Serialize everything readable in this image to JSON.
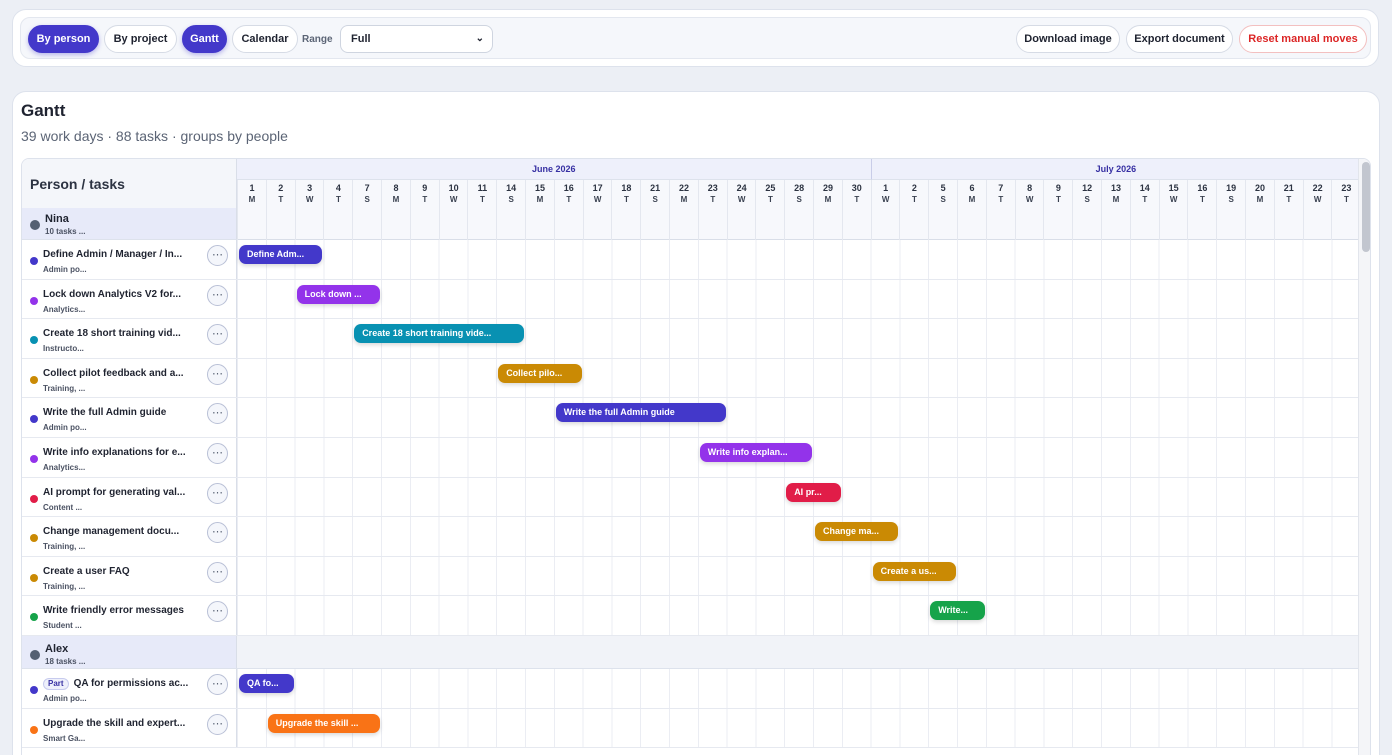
{
  "toolbar": {
    "by_person": "By person",
    "by_project": "By project",
    "gantt": "Gantt",
    "calendar": "Calendar",
    "range_label": "Range",
    "range_value": "Full",
    "download": "Download image",
    "export": "Export document",
    "reset": "Reset manual moves"
  },
  "card": {
    "title": "Gantt",
    "subtitle": "39 work days · 88 tasks · groups by people"
  },
  "left_header": "Person / tasks",
  "months": [
    {
      "label": "June 2026",
      "start": 0,
      "span": 22
    },
    {
      "label": "July 2026",
      "start": 22,
      "span": 17
    }
  ],
  "days": [
    {
      "n": "1",
      "w": "M"
    },
    {
      "n": "2",
      "w": "T"
    },
    {
      "n": "3",
      "w": "W"
    },
    {
      "n": "4",
      "w": "T"
    },
    {
      "n": "7",
      "w": "S"
    },
    {
      "n": "8",
      "w": "M"
    },
    {
      "n": "9",
      "w": "T"
    },
    {
      "n": "10",
      "w": "W"
    },
    {
      "n": "11",
      "w": "T"
    },
    {
      "n": "14",
      "w": "S"
    },
    {
      "n": "15",
      "w": "M"
    },
    {
      "n": "16",
      "w": "T"
    },
    {
      "n": "17",
      "w": "W"
    },
    {
      "n": "18",
      "w": "T"
    },
    {
      "n": "21",
      "w": "S"
    },
    {
      "n": "22",
      "w": "M"
    },
    {
      "n": "23",
      "w": "T"
    },
    {
      "n": "24",
      "w": "W"
    },
    {
      "n": "25",
      "w": "T"
    },
    {
      "n": "28",
      "w": "S"
    },
    {
      "n": "29",
      "w": "M"
    },
    {
      "n": "30",
      "w": "T"
    },
    {
      "n": "1",
      "w": "W"
    },
    {
      "n": "2",
      "w": "T"
    },
    {
      "n": "5",
      "w": "S"
    },
    {
      "n": "6",
      "w": "M"
    },
    {
      "n": "7",
      "w": "T"
    },
    {
      "n": "8",
      "w": "W"
    },
    {
      "n": "9",
      "w": "T"
    },
    {
      "n": "12",
      "w": "S"
    },
    {
      "n": "13",
      "w": "M"
    },
    {
      "n": "14",
      "w": "T"
    },
    {
      "n": "15",
      "w": "W"
    },
    {
      "n": "16",
      "w": "T"
    },
    {
      "n": "19",
      "w": "S"
    },
    {
      "n": "20",
      "w": "M"
    },
    {
      "n": "21",
      "w": "T"
    },
    {
      "n": "22",
      "w": "W"
    },
    {
      "n": "23",
      "w": "T"
    }
  ],
  "groups": [
    {
      "name": "Nina",
      "count": "10 tasks ...",
      "tasks": [
        {
          "title": "Define Admin / Manager / In...",
          "sub": "Admin po...",
          "color": "#4338ca",
          "bar": "Define Adm...",
          "start": 0,
          "span": 3
        },
        {
          "title": "Lock down Analytics V2 for...",
          "sub": "Analytics...",
          "color": "#9333ea",
          "bar": "Lock down ...",
          "start": 2,
          "span": 3
        },
        {
          "title": "Create 18 short training vid...",
          "sub": "Instructo...",
          "color": "#0891b2",
          "bar": "Create 18 short training vide...",
          "start": 4,
          "span": 6
        },
        {
          "title": "Collect pilot feedback and a...",
          "sub": "Training, ...",
          "color": "#ca8a04",
          "bar": "Collect pilo...",
          "start": 9,
          "span": 3
        },
        {
          "title": "Write the full Admin guide",
          "sub": "Admin po...",
          "color": "#4338ca",
          "bar": "Write the full Admin guide",
          "start": 11,
          "span": 6
        },
        {
          "title": "Write info explanations for e...",
          "sub": "Analytics...",
          "color": "#9333ea",
          "bar": "Write info explan...",
          "start": 16,
          "span": 4
        },
        {
          "title": "AI prompt for generating val...",
          "sub": "Content ...",
          "color": "#e11d48",
          "bar": "AI pr...",
          "start": 19,
          "span": 2
        },
        {
          "title": "Change management docu...",
          "sub": "Training, ...",
          "color": "#ca8a04",
          "bar": "Change ma...",
          "start": 20,
          "span": 3
        },
        {
          "title": "Create a user FAQ",
          "sub": "Training, ...",
          "color": "#ca8a04",
          "bar": "Create a us...",
          "start": 22,
          "span": 3
        },
        {
          "title": "Write friendly error messages",
          "sub": "Student ...",
          "color": "#16a34a",
          "bar": "Write...",
          "start": 24,
          "span": 2
        }
      ]
    },
    {
      "name": "Alex",
      "count": "18 tasks ...",
      "tasks": [
        {
          "title": "QA for permissions ac...",
          "part": "Part",
          "sub": "Admin po...",
          "color": "#4338ca",
          "bar": "QA fo...",
          "start": 0,
          "span": 2
        },
        {
          "title": "Upgrade the skill and expert...",
          "sub": "Smart Ga...",
          "color": "#f97316",
          "bar": "Upgrade the skill ...",
          "start": 1,
          "span": 4
        }
      ]
    }
  ]
}
